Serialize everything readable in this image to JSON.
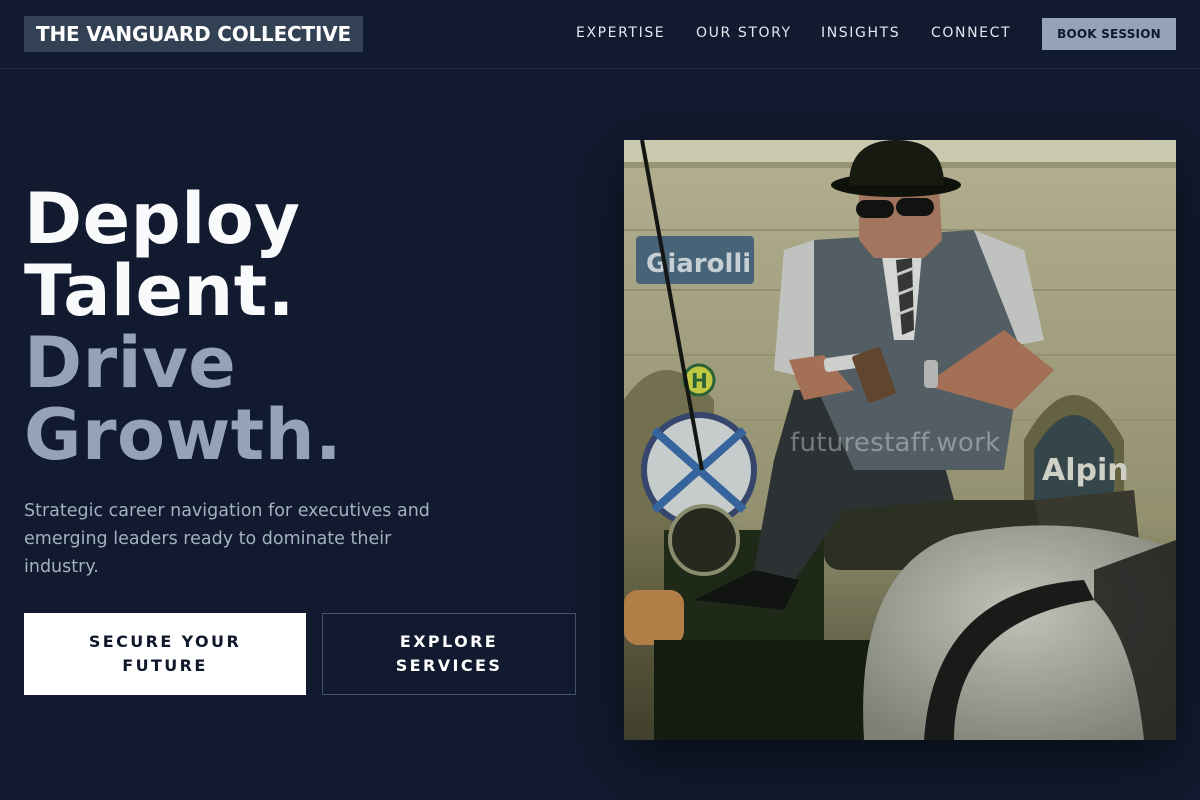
{
  "header": {
    "logo": "THE VANGUARD COLLECTIVE",
    "nav": [
      "EXPERTISE",
      "OUR STORY",
      "INSIGHTS",
      "CONNECT"
    ],
    "cta": "BOOK SESSION"
  },
  "hero": {
    "headline_line1": "Deploy",
    "headline_line2": "Talent.",
    "headline_line3": "Drive",
    "headline_line4": "Growth.",
    "subtext": "Strategic career navigation for executives and emerging leaders ready to dominate their industry.",
    "primary_cta": "SECURE YOUR FUTURE",
    "secondary_cta": "EXPLORE SERVICES"
  },
  "image": {
    "watermark": "futurestaff.work",
    "sign_text": "Giarolli",
    "sign_text_2": "Alpin",
    "bus_sign": "H"
  },
  "colors": {
    "background": "#111a2e",
    "logo_bg": "#334155",
    "accent_slate": "#94a3b8",
    "primary_button": "#ffffff"
  }
}
